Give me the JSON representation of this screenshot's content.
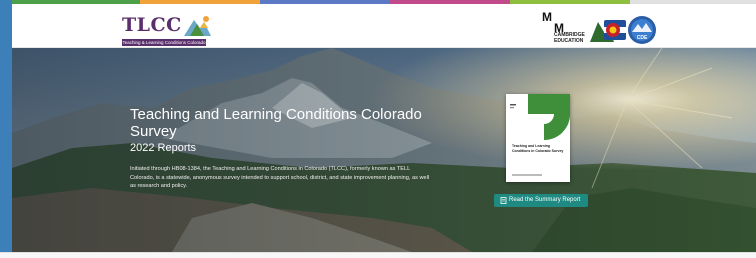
{
  "colors": {
    "strip": [
      "#4da04a",
      "#f2a23a",
      "#5b79c4",
      "#c04a8a",
      "#8fbf3e",
      "#e0e0e0"
    ],
    "left_edge": "#3d7fb8",
    "tlcc_purple": "#5a2d6b",
    "button": "#1f8a82",
    "cover_green": "#3e8e3a"
  },
  "header": {
    "tlcc_logo": {
      "wordmark": "TLCC",
      "tagline": "Teaching & Learning Conditions Colorado"
    },
    "partners": {
      "mm_letters": "M M",
      "mm_caption": "CAMBRIDGE\nEDUCATION",
      "state_logo": "colorado-c-icon",
      "cde_label": "CDE"
    }
  },
  "hero": {
    "title": "Teaching and Learning Conditions Colorado Survey",
    "subtitle": "2022 Reports",
    "description": "Initiated through HB08-1384, the Teaching and Learning Conditions in Colorado (TLCC), formerly known as TELL Colorado, is a statewide, anonymous survey intended to support school, district, and state improvement planning, as well as research and policy.",
    "report_cover_title": "Teaching and Learning Conditions in Colorado Survey",
    "cta_label": "Read the Summary Report",
    "cta_icon": "document-icon"
  }
}
